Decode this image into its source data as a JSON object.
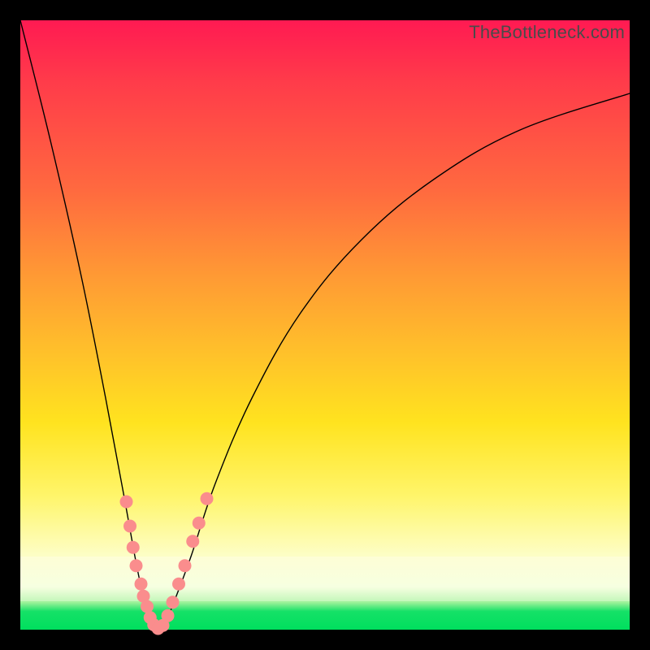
{
  "watermark": "TheBottleneck.com",
  "chart_data": {
    "type": "line",
    "title": "",
    "xlabel": "",
    "ylabel": "",
    "xlim": [
      0,
      100
    ],
    "ylim": [
      0,
      100
    ],
    "grid": false,
    "legend": false,
    "series": [
      {
        "name": "bottleneck-curve",
        "x": [
          0,
          5,
          10,
          14,
          17,
          19,
          20.5,
          21.6,
          22.5,
          23.5,
          25,
          28,
          32,
          38,
          46,
          56,
          68,
          82,
          100
        ],
        "y": [
          100,
          80,
          58,
          38,
          22,
          11,
          4,
          0.5,
          0,
          0.5,
          4,
          12,
          24,
          38,
          52,
          64,
          74,
          82,
          88
        ]
      }
    ],
    "markers": {
      "name": "highlight-dots",
      "color": "#fa8d8d",
      "points": [
        {
          "x": 17.4,
          "y": 21
        },
        {
          "x": 18.0,
          "y": 17
        },
        {
          "x": 18.5,
          "y": 13.5
        },
        {
          "x": 19.0,
          "y": 10.5
        },
        {
          "x": 19.8,
          "y": 7.5
        },
        {
          "x": 20.2,
          "y": 5.5
        },
        {
          "x": 20.8,
          "y": 3.8
        },
        {
          "x": 21.3,
          "y": 2.0
        },
        {
          "x": 21.9,
          "y": 0.8
        },
        {
          "x": 22.6,
          "y": 0.2
        },
        {
          "x": 23.4,
          "y": 0.7
        },
        {
          "x": 24.2,
          "y": 2.3
        },
        {
          "x": 25.0,
          "y": 4.5
        },
        {
          "x": 26.0,
          "y": 7.5
        },
        {
          "x": 27.0,
          "y": 10.5
        },
        {
          "x": 28.3,
          "y": 14.5
        },
        {
          "x": 29.3,
          "y": 17.5
        },
        {
          "x": 30.6,
          "y": 21.5
        }
      ]
    },
    "background": {
      "type": "vertical-gradient",
      "stops": [
        {
          "pos": 0.0,
          "color": "#ff1a52"
        },
        {
          "pos": 0.3,
          "color": "#ff7a38"
        },
        {
          "pos": 0.6,
          "color": "#ffe31f"
        },
        {
          "pos": 0.9,
          "color": "#f8ffd0"
        },
        {
          "pos": 0.97,
          "color": "#15e167"
        },
        {
          "pos": 1.0,
          "color": "#00df5e"
        }
      ]
    }
  }
}
